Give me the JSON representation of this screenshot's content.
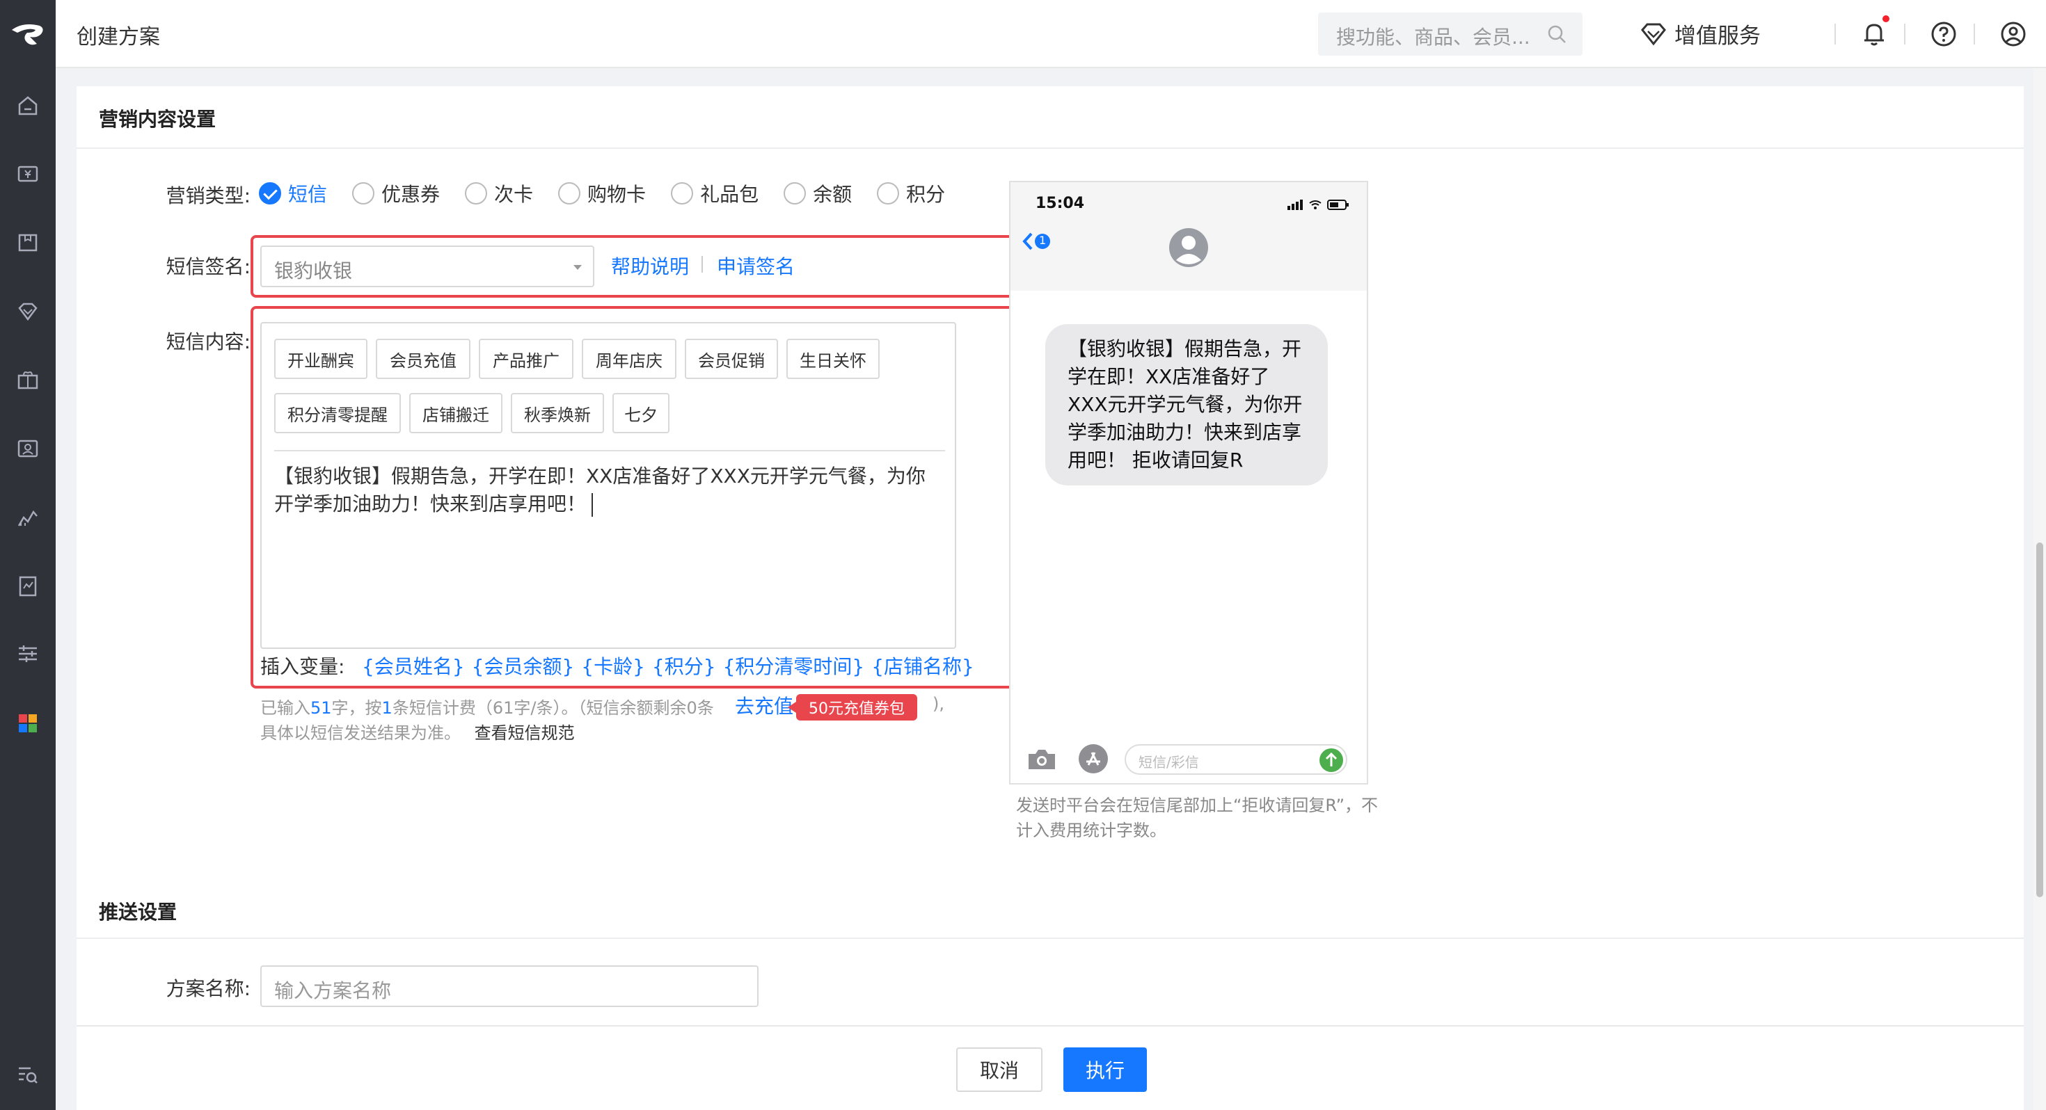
{
  "topbar": {
    "page_title": "创建方案",
    "search_placeholder": "搜功能、商品、会员...",
    "value_added_label": "增值服务"
  },
  "sidebar": {
    "icons": [
      "home-icon",
      "cashier-icon",
      "inventory-icon",
      "vip-icon",
      "marketing-icon",
      "member-card-icon",
      "report-icon",
      "finance-icon",
      "settings-icon",
      "apps-icon",
      "help-search-icon"
    ]
  },
  "section1": {
    "title": "营销内容设置",
    "type_label": "营销类型:",
    "types": [
      {
        "label": "短信",
        "selected": true
      },
      {
        "label": "优惠券",
        "selected": false
      },
      {
        "label": "次卡",
        "selected": false
      },
      {
        "label": "购物卡",
        "selected": false
      },
      {
        "label": "礼品包",
        "selected": false
      },
      {
        "label": "余额",
        "selected": false
      },
      {
        "label": "积分",
        "selected": false
      }
    ],
    "signature_label": "短信签名:",
    "signature_value": "银豹收银",
    "help_link": "帮助说明",
    "apply_link": "申请签名",
    "content_label": "短信内容:",
    "templates_row1": [
      "开业酬宾",
      "会员充值",
      "产品推广",
      "周年店庆",
      "会员促销",
      "生日关怀"
    ],
    "templates_row2": [
      "积分清零提醒",
      "店铺搬迁",
      "秋季焕新",
      "七夕"
    ],
    "message_text": "【银豹收银】假期告急，开学在即！XX店准备好了XXX元开学元气餐，为你开学季加油助力！快来到店享用吧！",
    "insert_label": "插入变量:",
    "variables": [
      "{会员姓名}",
      "{会员余额}",
      "{卡龄}",
      "{积分}",
      "{积分清零时间}",
      "{店铺名称}"
    ],
    "hint": {
      "p1": "已输入",
      "count": "51",
      "p2": "字，按",
      "msgs": "1",
      "p3": "条短信计费（61字/条）。（短信余额剩余0条",
      "recharge_link": "去充值",
      "badge": "50元充值券包",
      "p4": "),",
      "line2": "具体以短信发送结果为准。",
      "spec_link": "查看短信规范"
    }
  },
  "phone": {
    "time": "15:04",
    "back_count": "1",
    "bubble": "【银豹收银】假期告急，开学在即！XX店准备好了XXX元开学元气餐，为你开学季加油助力！快来到店享用吧！ 拒收请回复R",
    "input_placeholder": "短信/彩信",
    "note": "发送时平台会在短信尾部加上“拒收请回复R”，不计入费用统计字数。"
  },
  "section2": {
    "title": "推送设置",
    "name_label": "方案名称:",
    "name_placeholder": "输入方案名称"
  },
  "footer": {
    "cancel": "取消",
    "execute": "执行"
  },
  "colors": {
    "primary": "#1677ff",
    "highlight_red": "#e8454d",
    "sidebar_bg": "#2f3238"
  }
}
